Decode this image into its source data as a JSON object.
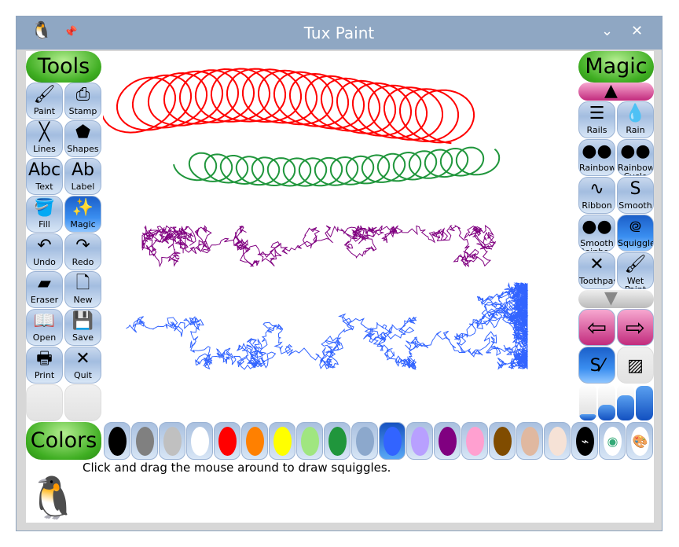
{
  "window": {
    "title": "Tux Paint",
    "minimize_icon": "chevron-down",
    "close_icon": "close"
  },
  "tools": {
    "header": "Tools",
    "items": [
      {
        "label": "Paint",
        "icon": "🖌"
      },
      {
        "label": "Stamp",
        "icon": "⎙"
      },
      {
        "label": "Lines",
        "icon": "╳"
      },
      {
        "label": "Shapes",
        "icon": "⬟"
      },
      {
        "label": "Text",
        "icon": "Abc"
      },
      {
        "label": "Label",
        "icon": "Ab"
      },
      {
        "label": "Fill",
        "icon": "🪣"
      },
      {
        "label": "Magic",
        "icon": "✨"
      },
      {
        "label": "Undo",
        "icon": "↶"
      },
      {
        "label": "Redo",
        "icon": "↷"
      },
      {
        "label": "Eraser",
        "icon": "▰"
      },
      {
        "label": "New",
        "icon": "🗋"
      },
      {
        "label": "Open",
        "icon": "📖"
      },
      {
        "label": "Save",
        "icon": "💾"
      },
      {
        "label": "Print",
        "icon": "🖶"
      },
      {
        "label": "Quit",
        "icon": "✕"
      }
    ],
    "selected": "Magic"
  },
  "magic": {
    "header": "Magic",
    "items": [
      {
        "label": "Rails",
        "icon": "☰"
      },
      {
        "label": "Rain",
        "icon": "💧"
      },
      {
        "label": "Rainbow",
        "icon": "●●"
      },
      {
        "label": "Rainbow Cycle",
        "icon": "●●"
      },
      {
        "label": "Ribbon",
        "icon": "∿"
      },
      {
        "label": "Smooth",
        "icon": "S"
      },
      {
        "label": "Smooth Rainbow",
        "icon": "●●"
      },
      {
        "label": "Squiggles",
        "icon": "᪤"
      },
      {
        "label": "Toothpaste",
        "icon": "✕"
      },
      {
        "label": "Wet Paint",
        "icon": "🖌"
      }
    ],
    "selected": "Squiggles",
    "mode": "paint",
    "size_level": 4
  },
  "colors": {
    "header": "Colors",
    "swatches": [
      "#000000",
      "#808080",
      "#c0c0c0",
      "#ffffff",
      "#ff0000",
      "#ff8000",
      "#ffff00",
      "#a0e680",
      "#20963c",
      "#8ca8cc",
      "#3264ff",
      "#b8a0ff",
      "#800080",
      "#ffa0d0",
      "#804c00",
      "#e0b8a0",
      "#f6e2d6"
    ],
    "selected": "#3264ff",
    "extras": [
      "color-picker",
      "rainbow-picker",
      "palette"
    ]
  },
  "status": {
    "message": "Click and drag the mouse around to draw squiggles."
  },
  "canvas": {
    "stroke_colors": [
      "#ff0000",
      "#20963c",
      "#800080",
      "#3264ff"
    ]
  }
}
